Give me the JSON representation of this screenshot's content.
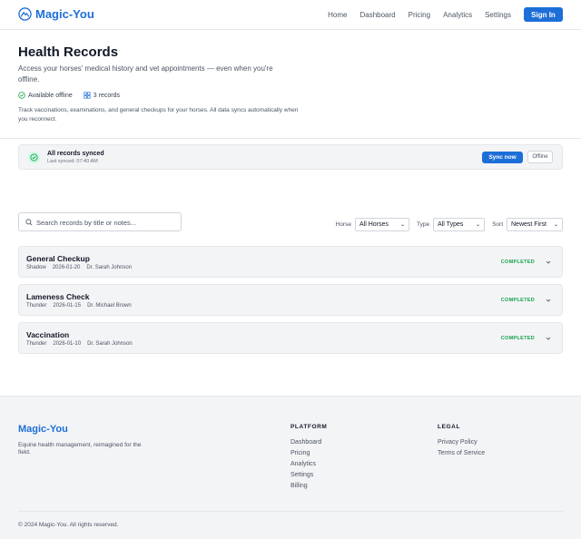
{
  "header": {
    "brand": "Magic-You",
    "nav": [
      "Home",
      "Dashboard",
      "Pricing",
      "Analytics",
      "Settings"
    ],
    "signin_label": "Sign In"
  },
  "hero": {
    "title": "Health Records",
    "subtitle": "Access your horses' medical history and vet appointments — even when you're offline.",
    "badge_offline": "Available offline",
    "badge_records": "3 records",
    "description": "Track vaccinations, examinations, and general checkups for your horses. All data syncs automatically when you reconnect."
  },
  "sync": {
    "title": "All records synced",
    "last_synced": "Last synced: 07:40 AM",
    "sync_label": "Sync now",
    "offline_label": "Offline"
  },
  "search": {
    "placeholder": "Search records by title or notes..."
  },
  "filters": {
    "horse_label": "Horse",
    "horse_value": "All Horses",
    "type_label": "Type",
    "type_value": "All Types",
    "sort_label": "Sort",
    "sort_value": "Newest First"
  },
  "records": [
    {
      "title": "General Checkup",
      "horse": "Shadow",
      "date": "2026-01-20",
      "vet": "Dr. Sarah Johnson",
      "status": "COMPLETED"
    },
    {
      "title": "Lameness Check",
      "horse": "Thunder",
      "date": "2026-01-15",
      "vet": "Dr. Michael Brown",
      "status": "COMPLETED"
    },
    {
      "title": "Vaccination",
      "horse": "Thunder",
      "date": "2026-01-10",
      "vet": "Dr. Sarah Johnson",
      "status": "COMPLETED"
    }
  ],
  "footer": {
    "brand": "Magic-You",
    "tagline": "Equine health management, reimagined for the field.",
    "platform_heading": "PLATFORM",
    "platform_links": [
      "Dashboard",
      "Pricing",
      "Analytics",
      "Settings",
      "Billing"
    ],
    "legal_heading": "LEGAL",
    "legal_links": [
      "Privacy Policy",
      "Terms of Service"
    ],
    "copyright": "© 2024 Magic-You. All rights reserved."
  },
  "colors": {
    "accent": "#1d6fd8",
    "success": "#16a34a",
    "surface": "#f3f4f6"
  }
}
